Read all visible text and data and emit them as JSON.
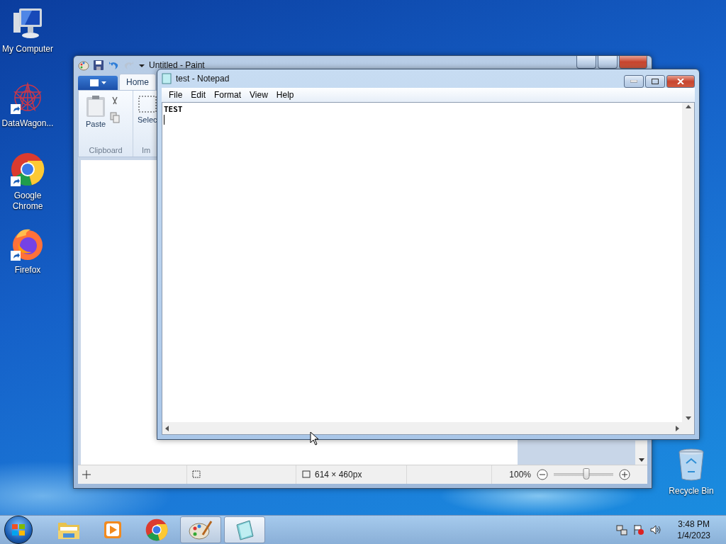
{
  "desktop_icons": [
    {
      "label": "My Computer",
      "kind": "computer",
      "shortcut": false
    },
    {
      "label": "DataWagon...",
      "kind": "datawagon",
      "shortcut": true
    },
    {
      "label": "Google Chrome",
      "kind": "chrome",
      "shortcut": true
    },
    {
      "label": "Firefox",
      "kind": "firefox",
      "shortcut": true
    },
    {
      "label": "Recycle Bin",
      "kind": "recycle",
      "shortcut": false
    }
  ],
  "paint": {
    "title": "Untitled - Paint",
    "tabs": [
      {
        "label": "Home",
        "selected": true
      }
    ],
    "paste": "Paste",
    "select": "Selec",
    "groups": [
      "Clipboard",
      "Im"
    ],
    "status": {
      "size": "614 × 460px",
      "zoom": "100%"
    },
    "zoom_slider": {
      "level": 0.55
    }
  },
  "notepad": {
    "title": "test - Notepad",
    "menu": [
      "File",
      "Edit",
      "Format",
      "View",
      "Help"
    ],
    "text": "TEST"
  },
  "taskbar": {
    "items": [
      {
        "kind": "explorer",
        "running": false,
        "selected": false
      },
      {
        "kind": "media",
        "running": false,
        "selected": false
      },
      {
        "kind": "chrome",
        "running": false,
        "selected": false
      },
      {
        "kind": "paint",
        "running": true,
        "selected": false
      },
      {
        "kind": "notepad",
        "running": true,
        "selected": true
      }
    ],
    "clock": {
      "time": "3:48 PM",
      "date": "1/4/2023"
    }
  }
}
